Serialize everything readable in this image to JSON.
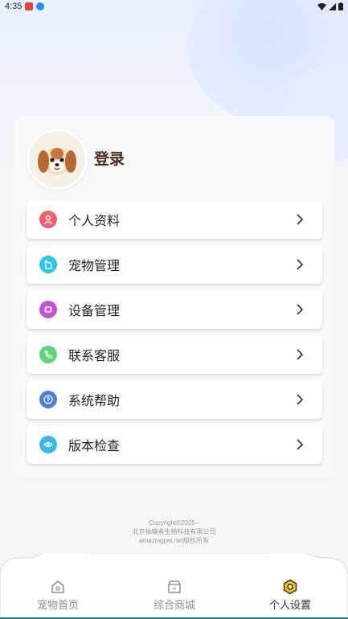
{
  "status_bar": {
    "time": "4:35"
  },
  "profile": {
    "login_label": "登录"
  },
  "menu": [
    {
      "label": "个人资料",
      "icon": "user-icon",
      "color": "#f0606a"
    },
    {
      "label": "宠物管理",
      "icon": "pet-icon",
      "color": "#2cc6e8"
    },
    {
      "label": "设备管理",
      "icon": "chip-icon",
      "color": "#c44fd9"
    },
    {
      "label": "联系客服",
      "icon": "phone-icon",
      "color": "#5fd37a"
    },
    {
      "label": "系统帮助",
      "icon": "help-icon",
      "color": "#4a7de4"
    },
    {
      "label": "版本检查",
      "icon": "eye-icon",
      "color": "#3cb7e6"
    }
  ],
  "footer": {
    "line1": "Copyright©2025--",
    "line2": "北京抽精者生物科技有限公司",
    "line3": "amazingpet.net版权所有"
  },
  "tabs": [
    {
      "label": "宠物首页",
      "icon": "pet-home-icon",
      "active": false
    },
    {
      "label": "综合商城",
      "icon": "shop-icon",
      "active": false
    },
    {
      "label": "个人设置",
      "icon": "settings-icon",
      "active": true
    }
  ],
  "colors": {
    "accent": "#333333",
    "login_text": "#4a2f1f",
    "active_tab_icon": "#f2c400"
  }
}
